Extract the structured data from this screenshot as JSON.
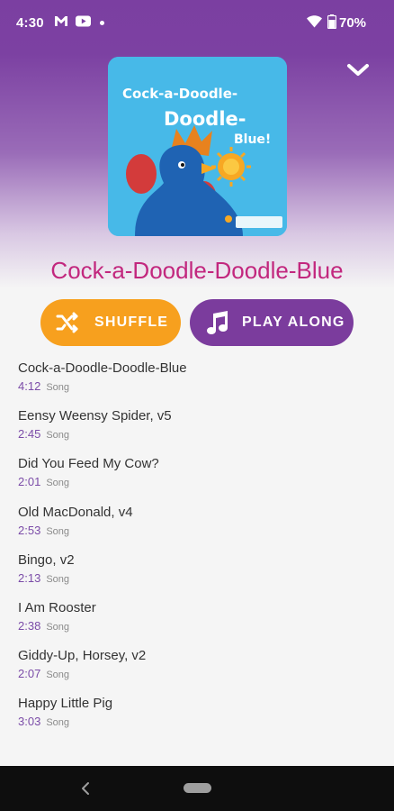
{
  "status_bar": {
    "time": "4:30",
    "battery": "70%",
    "icons": [
      "gmail-icon",
      "youtube-icon",
      "notification-dot",
      "wifi-icon",
      "battery-icon"
    ]
  },
  "header": {
    "collapse_icon": "chevron-down-icon",
    "album_art": {
      "line1": "Cock-a-Doodle-",
      "line2": "Doodle-",
      "line3": "Blue!"
    },
    "title": "Cock-a-Doodle-Doodle-Blue"
  },
  "actions": {
    "shuffle_label": "SHUFFLE",
    "shuffle_icon": "shuffle-icon",
    "play_along_label": "PLAY ALONG",
    "play_along_icon": "music-note-icon"
  },
  "songs": [
    {
      "title": "Cock-a-Doodle-Doodle-Blue",
      "duration": "4:12",
      "type": "Song"
    },
    {
      "title": "Eensy Weensy Spider, v5",
      "duration": "2:45",
      "type": "Song"
    },
    {
      "title": "Did You Feed My Cow?",
      "duration": "2:01",
      "type": "Song"
    },
    {
      "title": "Old MacDonald, v4",
      "duration": "2:53",
      "type": "Song"
    },
    {
      "title": "Bingo, v2",
      "duration": "2:13",
      "type": "Song"
    },
    {
      "title": "I Am Rooster",
      "duration": "2:38",
      "type": "Song"
    },
    {
      "title": "Giddy-Up, Horsey, v2",
      "duration": "2:07",
      "type": "Song"
    },
    {
      "title": "Happy Little Pig",
      "duration": "3:03",
      "type": "Song"
    }
  ],
  "colors": {
    "title": "#c2277e",
    "shuffle_button": "#f7a01e",
    "play_along_button": "#7b3c9d",
    "duration": "#7b4ca8",
    "header_gradient_top": "#7b3fa1"
  },
  "nav_bar": {
    "back_icon": "back-icon",
    "home_icon": "home-pill-icon"
  }
}
